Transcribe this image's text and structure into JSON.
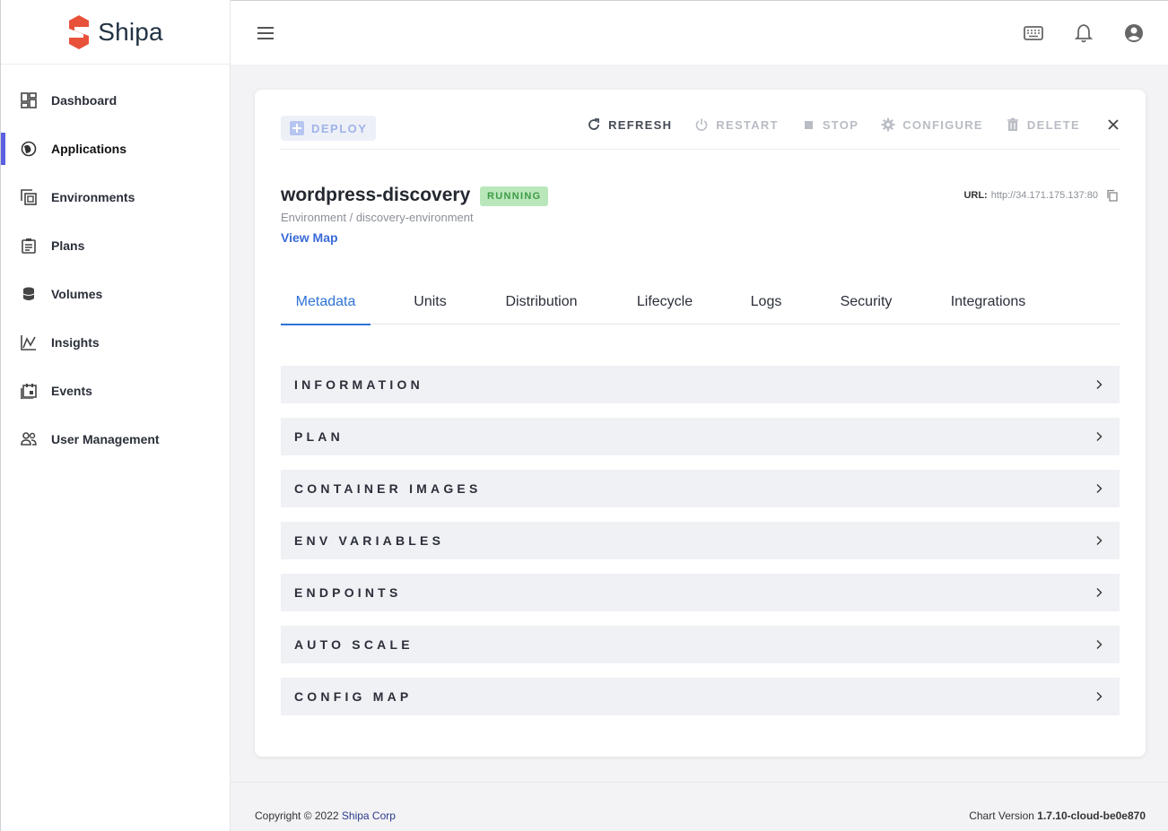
{
  "brand": {
    "name": "Shipa",
    "accent": "#e8513a"
  },
  "sidebar": {
    "items": [
      {
        "label": "Dashboard",
        "icon": "dashboard-icon"
      },
      {
        "label": "Applications",
        "icon": "applications-icon",
        "active": true
      },
      {
        "label": "Environments",
        "icon": "environments-icon"
      },
      {
        "label": "Plans",
        "icon": "plans-icon"
      },
      {
        "label": "Volumes",
        "icon": "volumes-icon"
      },
      {
        "label": "Insights",
        "icon": "insights-icon"
      },
      {
        "label": "Events",
        "icon": "events-icon"
      },
      {
        "label": "User Management",
        "icon": "users-icon"
      }
    ]
  },
  "toolbar": {
    "deploy": "DEPLOY",
    "refresh": "REFRESH",
    "restart": "RESTART",
    "stop": "STOP",
    "configure": "CONFIGURE",
    "delete": "DELETE"
  },
  "app": {
    "name": "wordpress-discovery",
    "status": "RUNNING",
    "breadcrumb": "Environment / discovery-environment",
    "view_map": "View Map",
    "url_label": "URL:",
    "url": "http://34.171.175.137:80"
  },
  "tabs": [
    {
      "label": "Metadata",
      "active": true
    },
    {
      "label": "Units"
    },
    {
      "label": "Distribution"
    },
    {
      "label": "Lifecycle"
    },
    {
      "label": "Logs"
    },
    {
      "label": "Security"
    },
    {
      "label": "Integrations"
    }
  ],
  "sections": [
    "INFORMATION",
    "PLAN",
    "CONTAINER IMAGES",
    "ENV VARIABLES",
    "ENDPOINTS",
    "AUTO SCALE",
    "CONFIG MAP"
  ],
  "footer": {
    "copyright": "Copyright © 2022",
    "company": "Shipa Corp",
    "chart_version_label": "Chart Version",
    "chart_version": "1.7.10-cloud-be0e870"
  }
}
